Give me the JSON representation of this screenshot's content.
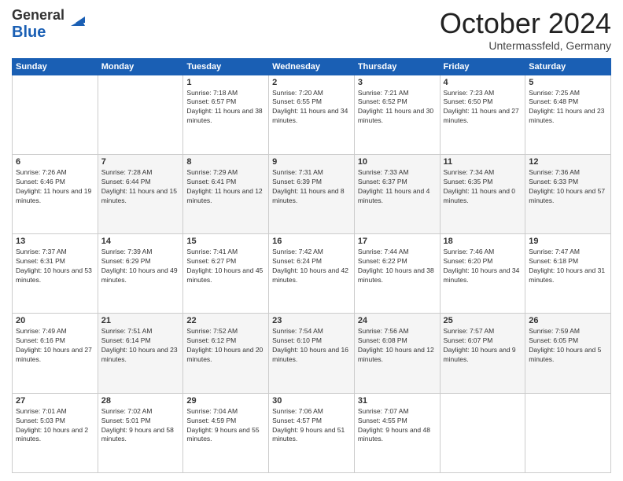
{
  "header": {
    "logo_general": "General",
    "logo_blue": "Blue",
    "month": "October 2024",
    "location": "Untermassfeld, Germany"
  },
  "columns": [
    "Sunday",
    "Monday",
    "Tuesday",
    "Wednesday",
    "Thursday",
    "Friday",
    "Saturday"
  ],
  "weeks": [
    [
      {
        "day": "",
        "sunrise": "",
        "sunset": "",
        "daylight": ""
      },
      {
        "day": "",
        "sunrise": "",
        "sunset": "",
        "daylight": ""
      },
      {
        "day": "1",
        "sunrise": "Sunrise: 7:18 AM",
        "sunset": "Sunset: 6:57 PM",
        "daylight": "Daylight: 11 hours and 38 minutes."
      },
      {
        "day": "2",
        "sunrise": "Sunrise: 7:20 AM",
        "sunset": "Sunset: 6:55 PM",
        "daylight": "Daylight: 11 hours and 34 minutes."
      },
      {
        "day": "3",
        "sunrise": "Sunrise: 7:21 AM",
        "sunset": "Sunset: 6:52 PM",
        "daylight": "Daylight: 11 hours and 30 minutes."
      },
      {
        "day": "4",
        "sunrise": "Sunrise: 7:23 AM",
        "sunset": "Sunset: 6:50 PM",
        "daylight": "Daylight: 11 hours and 27 minutes."
      },
      {
        "day": "5",
        "sunrise": "Sunrise: 7:25 AM",
        "sunset": "Sunset: 6:48 PM",
        "daylight": "Daylight: 11 hours and 23 minutes."
      }
    ],
    [
      {
        "day": "6",
        "sunrise": "Sunrise: 7:26 AM",
        "sunset": "Sunset: 6:46 PM",
        "daylight": "Daylight: 11 hours and 19 minutes."
      },
      {
        "day": "7",
        "sunrise": "Sunrise: 7:28 AM",
        "sunset": "Sunset: 6:44 PM",
        "daylight": "Daylight: 11 hours and 15 minutes."
      },
      {
        "day": "8",
        "sunrise": "Sunrise: 7:29 AM",
        "sunset": "Sunset: 6:41 PM",
        "daylight": "Daylight: 11 hours and 12 minutes."
      },
      {
        "day": "9",
        "sunrise": "Sunrise: 7:31 AM",
        "sunset": "Sunset: 6:39 PM",
        "daylight": "Daylight: 11 hours and 8 minutes."
      },
      {
        "day": "10",
        "sunrise": "Sunrise: 7:33 AM",
        "sunset": "Sunset: 6:37 PM",
        "daylight": "Daylight: 11 hours and 4 minutes."
      },
      {
        "day": "11",
        "sunrise": "Sunrise: 7:34 AM",
        "sunset": "Sunset: 6:35 PM",
        "daylight": "Daylight: 11 hours and 0 minutes."
      },
      {
        "day": "12",
        "sunrise": "Sunrise: 7:36 AM",
        "sunset": "Sunset: 6:33 PM",
        "daylight": "Daylight: 10 hours and 57 minutes."
      }
    ],
    [
      {
        "day": "13",
        "sunrise": "Sunrise: 7:37 AM",
        "sunset": "Sunset: 6:31 PM",
        "daylight": "Daylight: 10 hours and 53 minutes."
      },
      {
        "day": "14",
        "sunrise": "Sunrise: 7:39 AM",
        "sunset": "Sunset: 6:29 PM",
        "daylight": "Daylight: 10 hours and 49 minutes."
      },
      {
        "day": "15",
        "sunrise": "Sunrise: 7:41 AM",
        "sunset": "Sunset: 6:27 PM",
        "daylight": "Daylight: 10 hours and 45 minutes."
      },
      {
        "day": "16",
        "sunrise": "Sunrise: 7:42 AM",
        "sunset": "Sunset: 6:24 PM",
        "daylight": "Daylight: 10 hours and 42 minutes."
      },
      {
        "day": "17",
        "sunrise": "Sunrise: 7:44 AM",
        "sunset": "Sunset: 6:22 PM",
        "daylight": "Daylight: 10 hours and 38 minutes."
      },
      {
        "day": "18",
        "sunrise": "Sunrise: 7:46 AM",
        "sunset": "Sunset: 6:20 PM",
        "daylight": "Daylight: 10 hours and 34 minutes."
      },
      {
        "day": "19",
        "sunrise": "Sunrise: 7:47 AM",
        "sunset": "Sunset: 6:18 PM",
        "daylight": "Daylight: 10 hours and 31 minutes."
      }
    ],
    [
      {
        "day": "20",
        "sunrise": "Sunrise: 7:49 AM",
        "sunset": "Sunset: 6:16 PM",
        "daylight": "Daylight: 10 hours and 27 minutes."
      },
      {
        "day": "21",
        "sunrise": "Sunrise: 7:51 AM",
        "sunset": "Sunset: 6:14 PM",
        "daylight": "Daylight: 10 hours and 23 minutes."
      },
      {
        "day": "22",
        "sunrise": "Sunrise: 7:52 AM",
        "sunset": "Sunset: 6:12 PM",
        "daylight": "Daylight: 10 hours and 20 minutes."
      },
      {
        "day": "23",
        "sunrise": "Sunrise: 7:54 AM",
        "sunset": "Sunset: 6:10 PM",
        "daylight": "Daylight: 10 hours and 16 minutes."
      },
      {
        "day": "24",
        "sunrise": "Sunrise: 7:56 AM",
        "sunset": "Sunset: 6:08 PM",
        "daylight": "Daylight: 10 hours and 12 minutes."
      },
      {
        "day": "25",
        "sunrise": "Sunrise: 7:57 AM",
        "sunset": "Sunset: 6:07 PM",
        "daylight": "Daylight: 10 hours and 9 minutes."
      },
      {
        "day": "26",
        "sunrise": "Sunrise: 7:59 AM",
        "sunset": "Sunset: 6:05 PM",
        "daylight": "Daylight: 10 hours and 5 minutes."
      }
    ],
    [
      {
        "day": "27",
        "sunrise": "Sunrise: 7:01 AM",
        "sunset": "Sunset: 5:03 PM",
        "daylight": "Daylight: 10 hours and 2 minutes."
      },
      {
        "day": "28",
        "sunrise": "Sunrise: 7:02 AM",
        "sunset": "Sunset: 5:01 PM",
        "daylight": "Daylight: 9 hours and 58 minutes."
      },
      {
        "day": "29",
        "sunrise": "Sunrise: 7:04 AM",
        "sunset": "Sunset: 4:59 PM",
        "daylight": "Daylight: 9 hours and 55 minutes."
      },
      {
        "day": "30",
        "sunrise": "Sunrise: 7:06 AM",
        "sunset": "Sunset: 4:57 PM",
        "daylight": "Daylight: 9 hours and 51 minutes."
      },
      {
        "day": "31",
        "sunrise": "Sunrise: 7:07 AM",
        "sunset": "Sunset: 4:55 PM",
        "daylight": "Daylight: 9 hours and 48 minutes."
      },
      {
        "day": "",
        "sunrise": "",
        "sunset": "",
        "daylight": ""
      },
      {
        "day": "",
        "sunrise": "",
        "sunset": "",
        "daylight": ""
      }
    ]
  ]
}
